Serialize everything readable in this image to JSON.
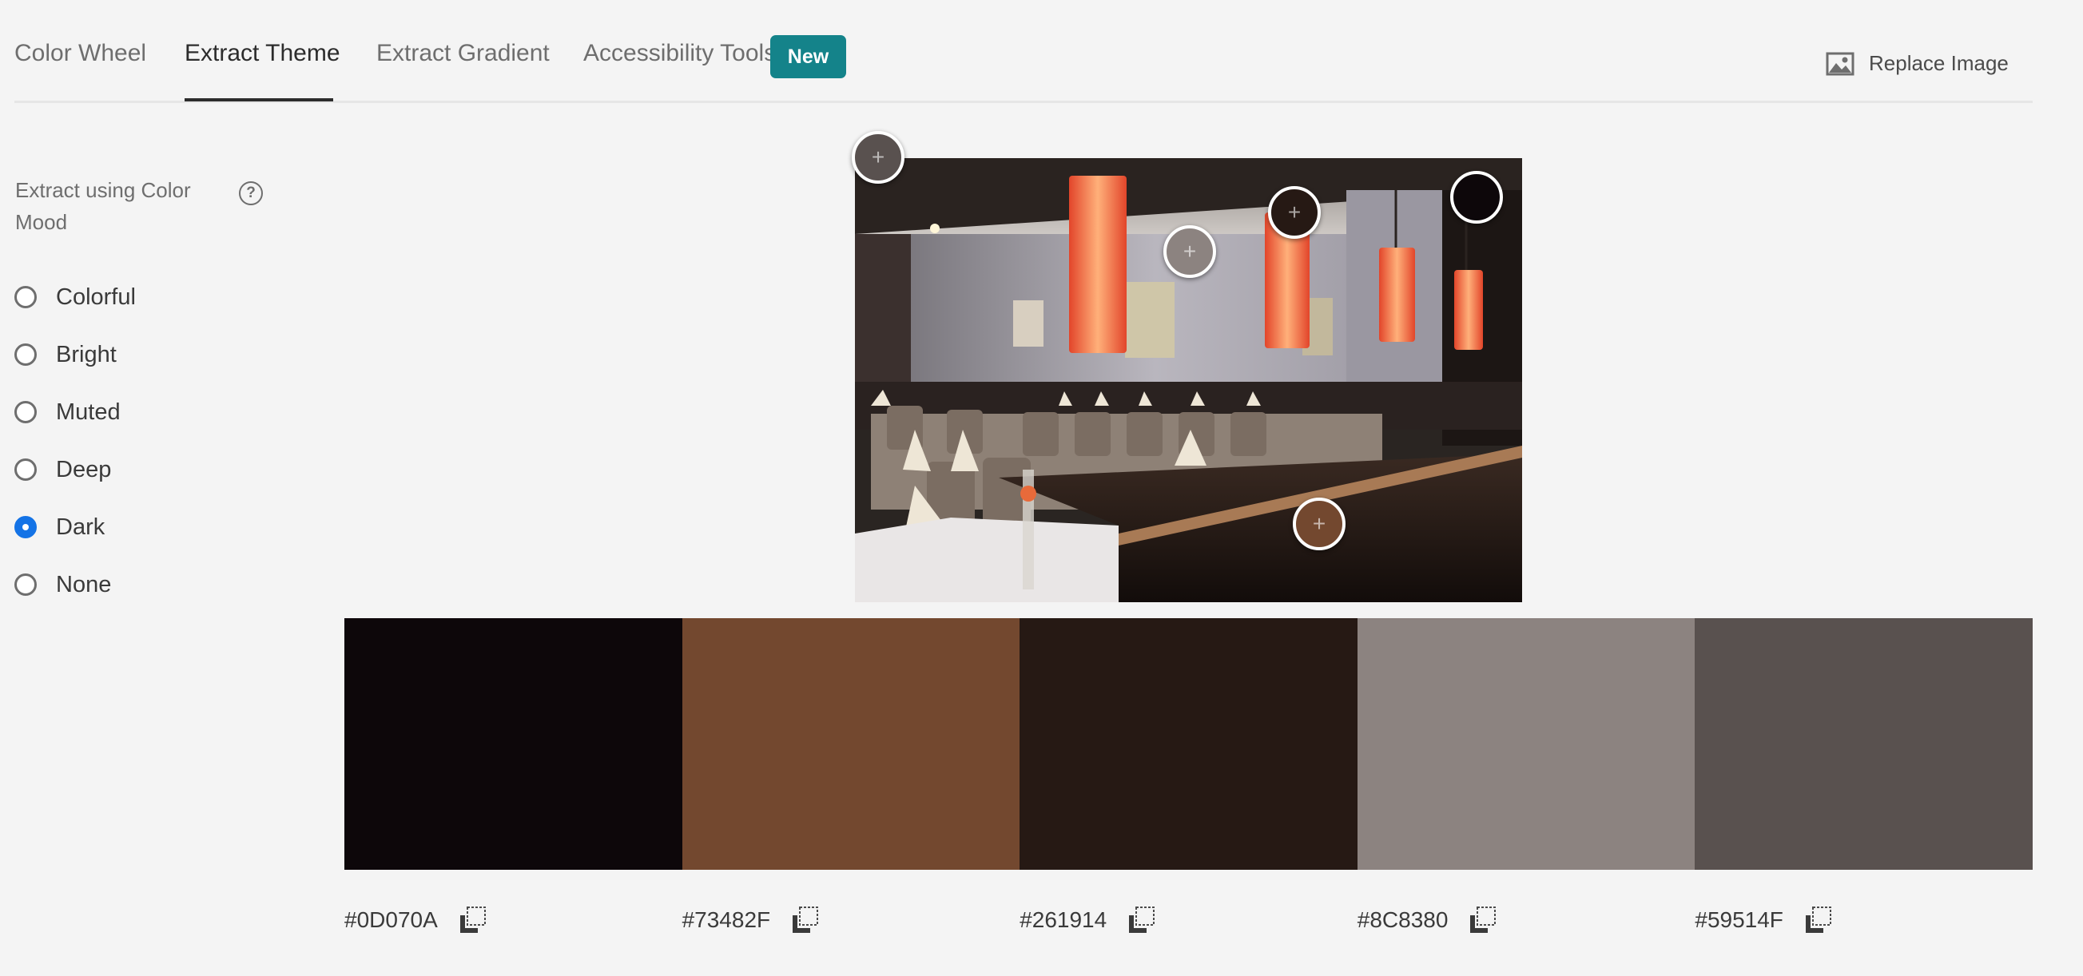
{
  "tabs": [
    {
      "label": "Color Wheel",
      "active": false
    },
    {
      "label": "Extract Theme",
      "active": true
    },
    {
      "label": "Extract Gradient",
      "active": false
    },
    {
      "label": "Accessibility Tools",
      "active": false
    }
  ],
  "badge": {
    "label": "New",
    "color": "#14838a"
  },
  "replace_image": {
    "label": "Replace Image",
    "icon": "image-icon"
  },
  "mood": {
    "label": "Extract using Color Mood",
    "help_icon": "?",
    "options": [
      {
        "label": "Colorful",
        "checked": false
      },
      {
        "label": "Bright",
        "checked": false
      },
      {
        "label": "Muted",
        "checked": false
      },
      {
        "label": "Deep",
        "checked": false
      },
      {
        "label": "Dark",
        "checked": true
      },
      {
        "label": "None",
        "checked": false
      }
    ]
  },
  "photo": {
    "subject": "restaurant interior with orange pendant lamps"
  },
  "pickers": [
    {
      "color": "#59514F"
    },
    {
      "color": "#8C8380"
    },
    {
      "color": "#261914"
    },
    {
      "color": "#0D070A"
    },
    {
      "color": "#73482F"
    }
  ],
  "swatches": [
    {
      "hex": "#0D070A",
      "color": "#0D070A"
    },
    {
      "hex": "#73482F",
      "color": "#73482F"
    },
    {
      "hex": "#261914",
      "color": "#261914"
    },
    {
      "hex": "#8C8380",
      "color": "#8C8380"
    },
    {
      "hex": "#59514F",
      "color": "#59514F"
    }
  ]
}
